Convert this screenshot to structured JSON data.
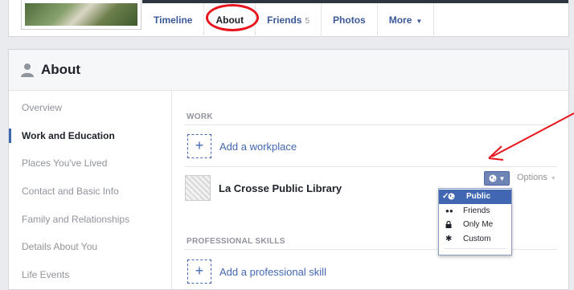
{
  "tabs": [
    {
      "label": "Timeline"
    },
    {
      "label": "About"
    },
    {
      "label": "Friends",
      "count": "5"
    },
    {
      "label": "Photos"
    },
    {
      "label": "More",
      "caret": "▼"
    }
  ],
  "about": {
    "title": "About",
    "sidebar": [
      {
        "label": "Overview"
      },
      {
        "label": "Work and Education"
      },
      {
        "label": "Places You've Lived"
      },
      {
        "label": "Contact and Basic Info"
      },
      {
        "label": "Family and Relationships"
      },
      {
        "label": "Details About You"
      },
      {
        "label": "Life Events"
      }
    ],
    "work": {
      "section_label": "WORK",
      "add_label": "Add a workplace",
      "plus": "+",
      "workplace": "La Crosse Public Library",
      "options_label": "Options"
    },
    "skills": {
      "section_label": "PROFESSIONAL SKILLS",
      "add_label": "Add a professional skill",
      "plus": "+"
    }
  },
  "privacy_menu": {
    "items": [
      {
        "label": "Public",
        "icon": "globe-icon",
        "check": "✓"
      },
      {
        "label": "Friends",
        "icon": "friends-icon",
        "glyph": "👥"
      },
      {
        "label": "Only Me",
        "icon": "lock-icon",
        "glyph": "🔒"
      },
      {
        "label": "Custom",
        "icon": "gear-icon",
        "glyph": "✱"
      }
    ]
  },
  "colors": {
    "accent": "#4267b2",
    "annotation": "#e8141c"
  }
}
